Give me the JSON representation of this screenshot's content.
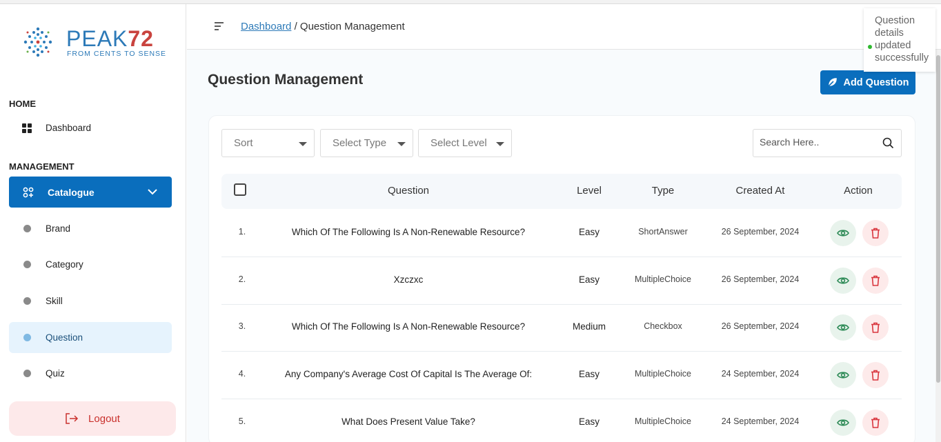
{
  "brand": {
    "name": "PEAK",
    "number": "72",
    "tagline": "FROM CENTS TO SENSE",
    "colors": {
      "primary": "#2d7ab8",
      "accent": "#c9433e"
    }
  },
  "sidebar": {
    "home_label": "HOME",
    "dashboard_label": "Dashboard",
    "management_label": "MANAGEMENT",
    "catalogue_label": "Catalogue",
    "items": [
      {
        "label": "Brand"
      },
      {
        "label": "Category"
      },
      {
        "label": "Skill"
      },
      {
        "label": "Question"
      },
      {
        "label": "Quiz"
      }
    ],
    "logout_label": "Logout"
  },
  "header": {
    "breadcrumb_link": "Dashboard",
    "breadcrumb_sep": "/",
    "breadcrumb_current": "Question Management"
  },
  "toast": {
    "message": "Question details updated successfully",
    "status_color": "#2eb82e"
  },
  "main": {
    "title": "Question Management",
    "add_button_label": "Add Question",
    "filters": {
      "sort": "Sort",
      "type": "Select Type",
      "level": "Select Level"
    },
    "search_placeholder": "Search Here..",
    "columns": {
      "question": "Question",
      "level": "Level",
      "type": "Type",
      "created": "Created At",
      "action": "Action"
    },
    "rows": [
      {
        "num": "1.",
        "question": "Which Of The Following Is A Non-Renewable Resource?",
        "level": "Easy",
        "type": "ShortAnswer",
        "created": "26 September, 2024"
      },
      {
        "num": "2.",
        "question": "Xzczxc",
        "level": "Easy",
        "type": "MultipleChoice",
        "created": "26 September, 2024"
      },
      {
        "num": "3.",
        "question": "Which Of The Following Is A Non-Renewable Resource?",
        "level": "Medium",
        "type": "Checkbox",
        "created": "26 September, 2024"
      },
      {
        "num": "4.",
        "question": "Any Company's Average Cost Of Capital Is The Average Of:",
        "level": "Easy",
        "type": "MultipleChoice",
        "created": "24 September, 2024"
      },
      {
        "num": "5.",
        "question": "What Does Present Value Take?",
        "level": "Easy",
        "type": "MultipleChoice",
        "created": "24 September, 2024"
      }
    ]
  },
  "icons": {
    "menu": "menu-lines-icon",
    "dashboard": "grid-icon",
    "catalogue": "apps-icon",
    "chevron": "chevron-down-icon",
    "logout": "logout-icon",
    "add": "feather-icon",
    "search": "search-icon",
    "view": "eye-icon",
    "delete": "trash-icon"
  }
}
